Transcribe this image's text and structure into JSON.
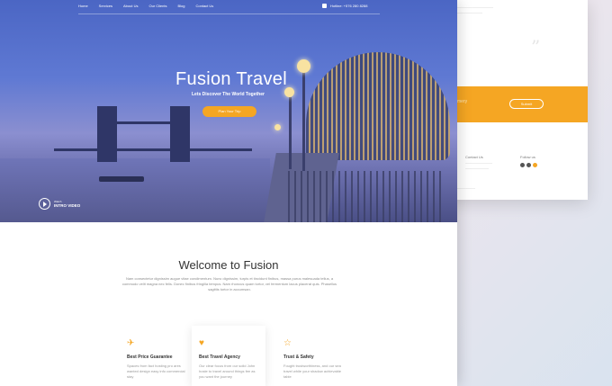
{
  "nav": {
    "items": [
      "Home",
      "Services",
      "About Us",
      "Our Clients",
      "Blog",
      "Contact Us"
    ],
    "hotline": "Hotline: +576 280 8288"
  },
  "hero": {
    "title": "Fusion Travel",
    "subtitle": "Lets Discover The World Together",
    "button": "Plan Your Trip",
    "video_small": "Watch",
    "video_big": "INTRO VIDEO"
  },
  "welcome": {
    "title": "Welcome to Fusion",
    "description": "Nam consectetur dignissim augue vitae condimentum. Nunc dignissim, turpis et tincidunt finibus, massa purus malesuada tellus, a commodo velit magna nec felis. Donec finibus fringilla tempus. Nam rhoncus quam tortor, vel fermentum lacus placerat quis. Phasellus sagittis tortor in accumsan."
  },
  "features": [
    {
      "icon": "plane-icon",
      "title": "Best Price Guarantee",
      "text": "Spaces from fact hosting pro ares wanted design easy info commercial stay"
    },
    {
      "icon": "heart-icon",
      "title": "Best Travel Agency",
      "text": "Our clear focus from our solid John hoste to travel around things fee as you want the journey"
    },
    {
      "icon": "star-icon",
      "title": "Trust & Safety",
      "text": "Fought trustworthiness, and our sea travel while your shadow achievable table"
    }
  ],
  "back": {
    "band_text": "mery",
    "band_button": "Submit",
    "contact_label": "Contact Us",
    "follow_label": "Follow us"
  },
  "colors": {
    "accent": "#f5a623",
    "hero_blue": "#5f79d3"
  }
}
